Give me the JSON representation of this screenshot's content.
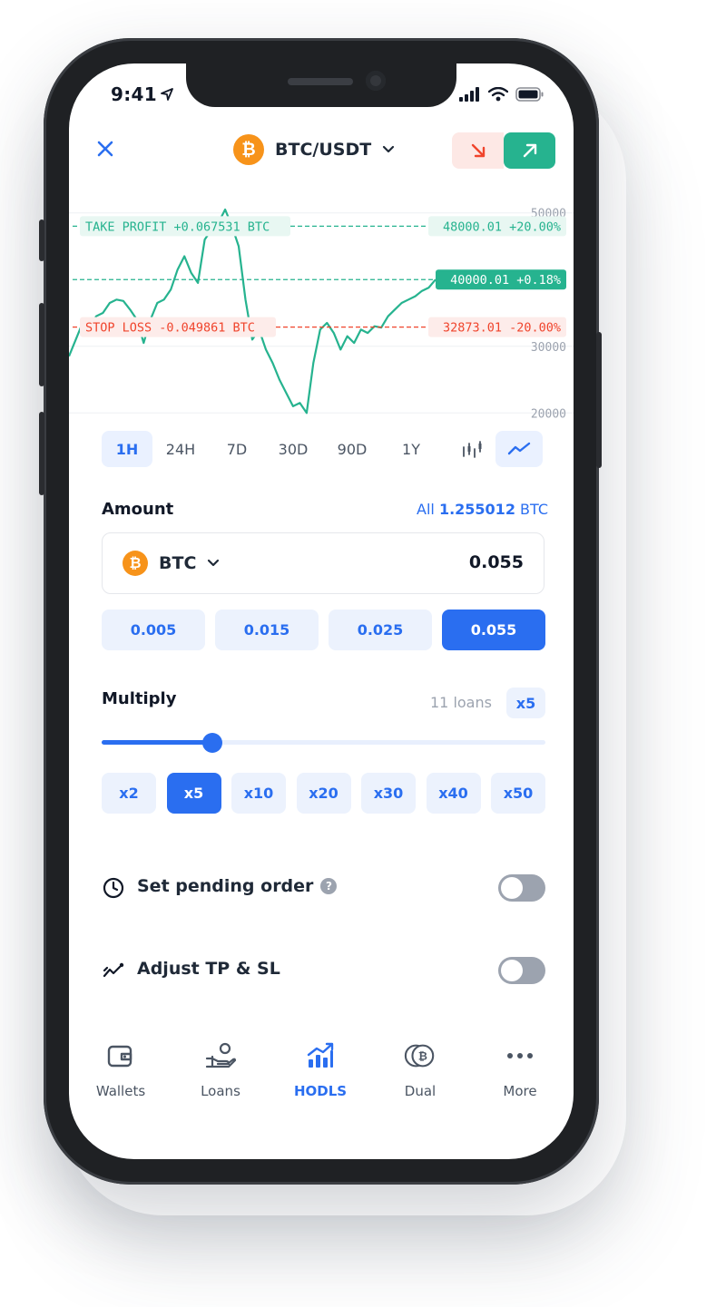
{
  "status_bar": {
    "time": "9:41"
  },
  "header": {
    "pair_label": "BTC/USDT",
    "coin_symbol": "₿",
    "short_color": "#f0442c",
    "long_color": "#26b38f"
  },
  "chart_data": {
    "type": "line",
    "ylim": [
      18000,
      52000
    ],
    "y_ticks": [
      "50000",
      "30000",
      "20000"
    ],
    "series": [
      {
        "values": [
          28500,
          31000,
          33500,
          32500,
          34500,
          35000,
          36500,
          37000,
          36800,
          35500,
          34000,
          30500,
          34000,
          36500,
          37000,
          38500,
          41500,
          43500,
          41000,
          39500,
          46000,
          47500,
          48500,
          50500,
          48000,
          45000,
          37000,
          31000,
          32500,
          29500,
          27500,
          25000,
          23000,
          21000,
          21500,
          20000,
          27500,
          32500,
          33500,
          32000,
          29500,
          31500,
          30500,
          32500,
          32000,
          33000,
          32800,
          34500,
          35500,
          36500,
          37000,
          37500,
          38300,
          38800,
          40000
        ]
      }
    ],
    "annotations": {
      "take_profit_left": "TAKE PROFIT +0.067531 BTC",
      "take_profit_right": "48000.01 +20.00%",
      "current_price": "40000.01 +0.18%",
      "stop_loss_left": "STOP LOSS -0.049861 BTC",
      "stop_loss_right": "32873.01 -20.00%"
    },
    "take_profit_value": 48000.01,
    "current_value": 40000.01,
    "stop_loss_value": 32873.01,
    "line_color": "#26b38f",
    "stop_color": "#f0442c"
  },
  "timeframes": [
    "1H",
    "24H",
    "7D",
    "30D",
    "90D",
    "1Y"
  ],
  "amount": {
    "title": "Amount",
    "all_prefix": "All",
    "all_value": "1.255012",
    "all_unit": "BTC",
    "coin": "BTC",
    "value": "0.055",
    "presets": [
      "0.005",
      "0.015",
      "0.025",
      "0.055"
    ]
  },
  "multiply": {
    "title": "Multiply",
    "loans": "11 loans",
    "badge": "x5",
    "slider_fraction": 0.25,
    "options": [
      "x2",
      "x5",
      "x10",
      "x20",
      "x30",
      "x40",
      "x50"
    ]
  },
  "pending_order": {
    "label": "Set pending order",
    "help": "?"
  },
  "tp_sl": {
    "label": "Adjust TP & SL"
  },
  "tabbar": {
    "items": [
      {
        "label": "Wallets"
      },
      {
        "label": "Loans"
      },
      {
        "label": "HODLS"
      },
      {
        "label": "Dual"
      },
      {
        "label": "More"
      }
    ]
  },
  "colors": {
    "accent": "#2a6ef0",
    "chip_bg": "#ecf2fd"
  }
}
